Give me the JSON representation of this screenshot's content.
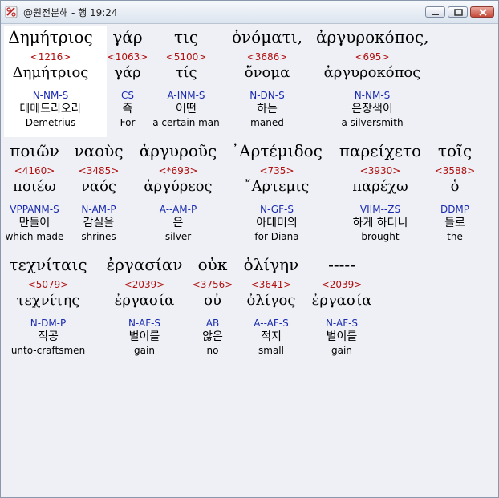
{
  "window": {
    "title": "@원전분해 - 행 19:24"
  },
  "verse_lines": [
    {
      "words": [
        {
          "greek": "Δημήτριος",
          "strong": "<1216>",
          "lemma": "Δημήτριος",
          "parse": "N-NM-S",
          "korean": "데메드리오라",
          "english": "Demetrius"
        },
        {
          "greek": "γάρ",
          "strong": "<1063>",
          "lemma": "γάρ",
          "parse": "CS",
          "korean": "즉",
          "english": "For"
        },
        {
          "greek": "τις",
          "strong": "<5100>",
          "lemma": "τίς",
          "parse": "A-INM-S",
          "korean": "어떤",
          "english": "a certain man"
        },
        {
          "greek": "ὀνόματι,",
          "strong": "<3686>",
          "lemma": "ὄνομα",
          "parse": "N-DN-S",
          "korean": "하는",
          "english": "maned"
        },
        {
          "greek": "ἀργυροκόπος,",
          "strong": "<695>",
          "lemma": "ἀργυροκόπος",
          "parse": "N-NM-S",
          "korean": "은장색이",
          "english": "a silversmith"
        }
      ]
    },
    {
      "words": [
        {
          "greek": "ποιῶν",
          "strong": "<4160>",
          "lemma": "ποιέω",
          "parse": "VPPANM-S",
          "korean": "만들어",
          "english": "which made"
        },
        {
          "greek": "ναοὺς",
          "strong": "<3485>",
          "lemma": "ναός",
          "parse": "N-AM-P",
          "korean": "감실을",
          "english": "shrines"
        },
        {
          "greek": "ἀργυροῦς",
          "strong": "<*693>",
          "lemma": "ἀργύρεος",
          "parse": "A--AM-P",
          "korean": "은",
          "english": "silver"
        },
        {
          "greek": "᾽Αρτέμιδος",
          "strong": "<735>",
          "lemma": "῎Αρτεμις",
          "parse": "N-GF-S",
          "korean": "아데미의",
          "english": "for Diana"
        },
        {
          "greek": "παρείχετο",
          "strong": "<3930>",
          "lemma": "παρέχω",
          "parse": "VIIM--ZS",
          "korean": "하게 하더니",
          "english": "brought"
        },
        {
          "greek": "τοῖς",
          "strong": "<3588>",
          "lemma": "ὁ",
          "parse": "DDMP",
          "korean": "들로",
          "english": "the"
        }
      ]
    },
    {
      "words": [
        {
          "greek": "τεχνίταις",
          "strong": "<5079>",
          "lemma": "τεχνίτης",
          "parse": "N-DM-P",
          "korean": "직공",
          "english": "unto-craftsmen"
        },
        {
          "greek": "ἐργασίαν",
          "strong": "<2039>",
          "lemma": "ἐργασία",
          "parse": "N-AF-S",
          "korean": "벌이를",
          "english": "gain"
        },
        {
          "greek": "οὐκ",
          "strong": "<3756>",
          "lemma": "οὐ",
          "parse": "AB",
          "korean": "않은",
          "english": "no"
        },
        {
          "greek": "ὀλίγην",
          "strong": "<3641>",
          "lemma": "ὀλίγος",
          "parse": "A--AF-S",
          "korean": "적지",
          "english": "small"
        },
        {
          "greek": "-----",
          "strong": "<2039>",
          "lemma": "ἐργασία",
          "parse": "N-AF-S",
          "korean": "벌이를",
          "english": "gain"
        }
      ]
    }
  ]
}
